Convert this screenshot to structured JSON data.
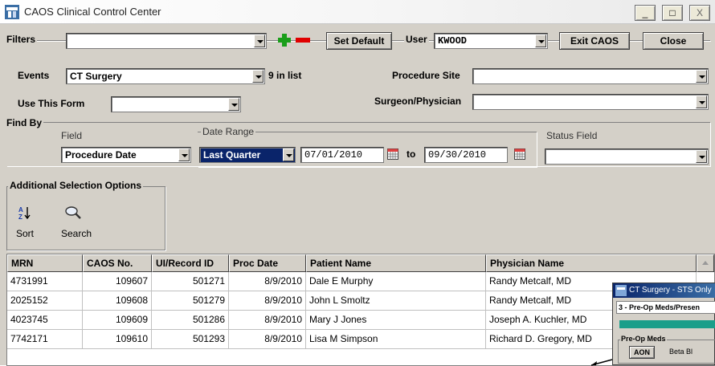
{
  "window": {
    "title": "CAOS Clinical Control Center",
    "minimize": "_",
    "maximize": "□",
    "close": "X"
  },
  "filters": {
    "label": "Filters",
    "value": "",
    "set_default": "Set Default",
    "user_label": "User",
    "user_value": "KWOOD",
    "exit": "Exit CAOS",
    "close": "Close"
  },
  "events": {
    "label": "Events",
    "value": "CT Surgery",
    "count": "9 in list"
  },
  "procedure_site": {
    "label": "Procedure Site",
    "value": ""
  },
  "use_form": {
    "label": "Use This Form",
    "value": ""
  },
  "surgeon": {
    "label": "Surgeon/Physician",
    "value": ""
  },
  "find_by": {
    "label": "Find By",
    "field_label": "Field",
    "field_value": "Procedure Date",
    "date_range_label": "Date Range",
    "date_range_value": "Last Quarter",
    "from": "07/01/2010",
    "to_label": "to",
    "to": "09/30/2010",
    "status_label": "Status Field",
    "status_value": ""
  },
  "additional": {
    "label": "Additional Selection Options",
    "sort": "Sort",
    "search": "Search"
  },
  "table": {
    "headers": [
      "MRN",
      "CAOS No.",
      "UI/Record ID",
      "Proc Date",
      "Patient Name",
      "Physician Name"
    ],
    "rows": [
      [
        "4731991",
        "109607",
        "501271",
        "8/9/2010",
        "Dale E Murphy",
        "Randy Metcalf, MD"
      ],
      [
        "2025152",
        "109608",
        "501279",
        "8/9/2010",
        "John L Smoltz",
        "Randy Metcalf, MD"
      ],
      [
        "4023745",
        "109609",
        "501286",
        "8/9/2010",
        "Mary J Jones",
        "Joseph A. Kuchler, MD"
      ],
      [
        "7742171",
        "109610",
        "501293",
        "8/9/2010",
        "Lisa M Simpson",
        "Richard D. Gregory, MD"
      ]
    ]
  },
  "popup": {
    "title": "CT Surgery - STS Only",
    "section": "3 - Pre-Op Meds/Presen",
    "group": "Pre-Op Meds",
    "button": "AON",
    "text": "Beta Bl"
  },
  "colors": {
    "window_bg": "#d4d0c8",
    "selection": "#0a246a",
    "add_green": "#1a9e1a",
    "remove_red": "#e00000"
  }
}
